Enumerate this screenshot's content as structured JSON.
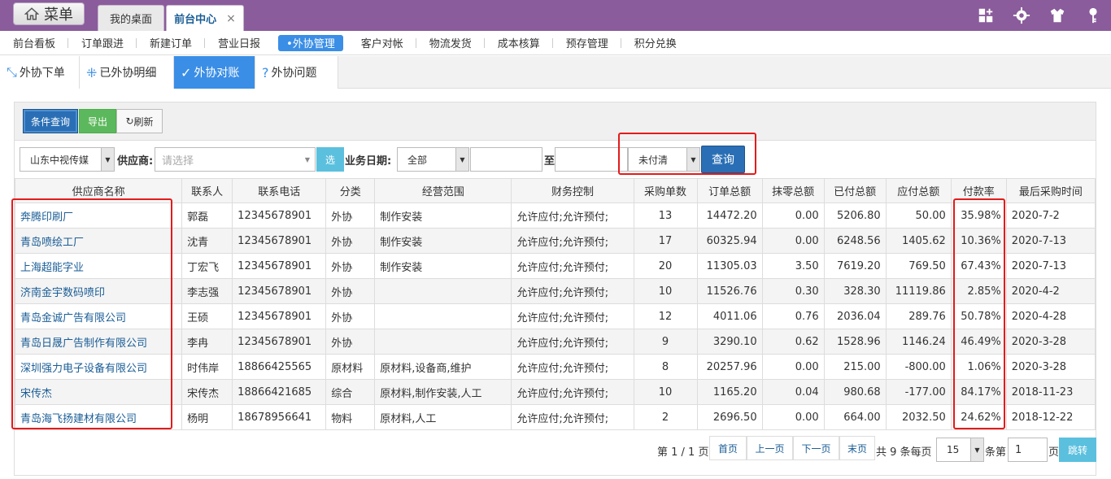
{
  "header": {
    "menu_label": "菜单",
    "tabs": [
      "我的桌面",
      "前台中心"
    ],
    "close_glyph": "×"
  },
  "nav": {
    "items": [
      "前台看板",
      "订单跟进",
      "新建订单",
      "营业日报",
      "•外协管理",
      "客户对帐",
      "物流发货",
      "成本核算",
      "预存管理",
      "积分兑换"
    ]
  },
  "subtabs": {
    "items": [
      {
        "icon": "⤡",
        "label": "外协下单"
      },
      {
        "icon": "⁜",
        "label": "已外协明细"
      },
      {
        "icon": "✓",
        "label": "外协对账"
      },
      {
        "icon": "?",
        "label": "外协问题"
      }
    ]
  },
  "toolbar": {
    "search_label": "条件查询",
    "export_label": "导出",
    "refresh_label": "刷新"
  },
  "filter": {
    "company": "山东中视传媒",
    "supplier_label": "供应商:",
    "supplier_placeholder": "请选择",
    "pick_label": "选",
    "date_label": "业务日期:",
    "date_range": "全部",
    "to_label": "至",
    "pay_status": "未付清",
    "query_label": "查询"
  },
  "table": {
    "headers": [
      "供应商名称",
      "联系人",
      "联系电话",
      "分类",
      "经营范围",
      "财务控制",
      "采购单数",
      "订单总额",
      "抹零总额",
      "已付总额",
      "应付总额",
      "付款率",
      "最后采购时间"
    ],
    "rows": [
      [
        "奔腾印刷厂",
        "郭磊",
        "12345678901",
        "外协",
        "制作安装",
        "允许应付;允许预付;",
        "13",
        "14472.20",
        "0.00",
        "5206.80",
        "50.00",
        "35.98%",
        "2020-7-2"
      ],
      [
        "青岛喷绘工厂",
        "沈青",
        "12345678901",
        "外协",
        "制作安装",
        "允许应付;允许预付;",
        "17",
        "60325.94",
        "0.00",
        "6248.56",
        "1405.62",
        "10.36%",
        "2020-7-13"
      ],
      [
        "上海超能字业",
        "丁宏飞",
        "12345678901",
        "外协",
        "制作安装",
        "允许应付;允许预付;",
        "20",
        "11305.03",
        "3.50",
        "7619.20",
        "769.50",
        "67.43%",
        "2020-7-13"
      ],
      [
        "济南金宇数码喷印",
        "李志强",
        "12345678901",
        "外协",
        "",
        "允许应付;允许预付;",
        "10",
        "11526.76",
        "0.30",
        "328.30",
        "11119.86",
        "2.85%",
        "2020-4-2"
      ],
      [
        "青岛金诚广告有限公司",
        "王硕",
        "12345678901",
        "外协",
        "",
        "允许应付;允许预付;",
        "12",
        "4011.06",
        "0.76",
        "2036.04",
        "289.76",
        "50.78%",
        "2020-4-28"
      ],
      [
        "青岛日晟广告制作有限公司",
        "李冉",
        "12345678901",
        "外协",
        "",
        "允许应付;允许预付;",
        "9",
        "3290.10",
        "0.62",
        "1528.96",
        "1146.24",
        "46.49%",
        "2020-3-28"
      ],
      [
        "深圳强力电子设备有限公司",
        "时伟岸",
        "18866425565",
        "原材料",
        "原材料,设备商,维护",
        "允许应付;允许预付;",
        "8",
        "20257.96",
        "0.00",
        "215.00",
        "-800.00",
        "1.06%",
        "2020-3-28"
      ],
      [
        "宋传杰",
        "宋传杰",
        "18866421685",
        "综合",
        "原材料,制作安装,人工",
        "允许应付;允许预付;",
        "10",
        "1165.20",
        "0.04",
        "980.68",
        "-177.00",
        "84.17%",
        "2018-11-23"
      ],
      [
        "青岛海飞扬建材有限公司",
        "杨明",
        "18678956641",
        "物料",
        "原材料,人工",
        "允许应付;允许预付;",
        "2",
        "2696.50",
        "0.00",
        "664.00",
        "2032.50",
        "24.62%",
        "2018-12-22"
      ]
    ]
  },
  "pager": {
    "page_info": "第 1 / 1 页",
    "first": "首页",
    "prev": "上一页",
    "next": "下一页",
    "last": "末页",
    "total_prefix": "共 9 条每页",
    "page_size": "15",
    "goto_prefix": "条第",
    "goto_value": "1",
    "goto_suffix": "页",
    "go_label": "跳转"
  }
}
